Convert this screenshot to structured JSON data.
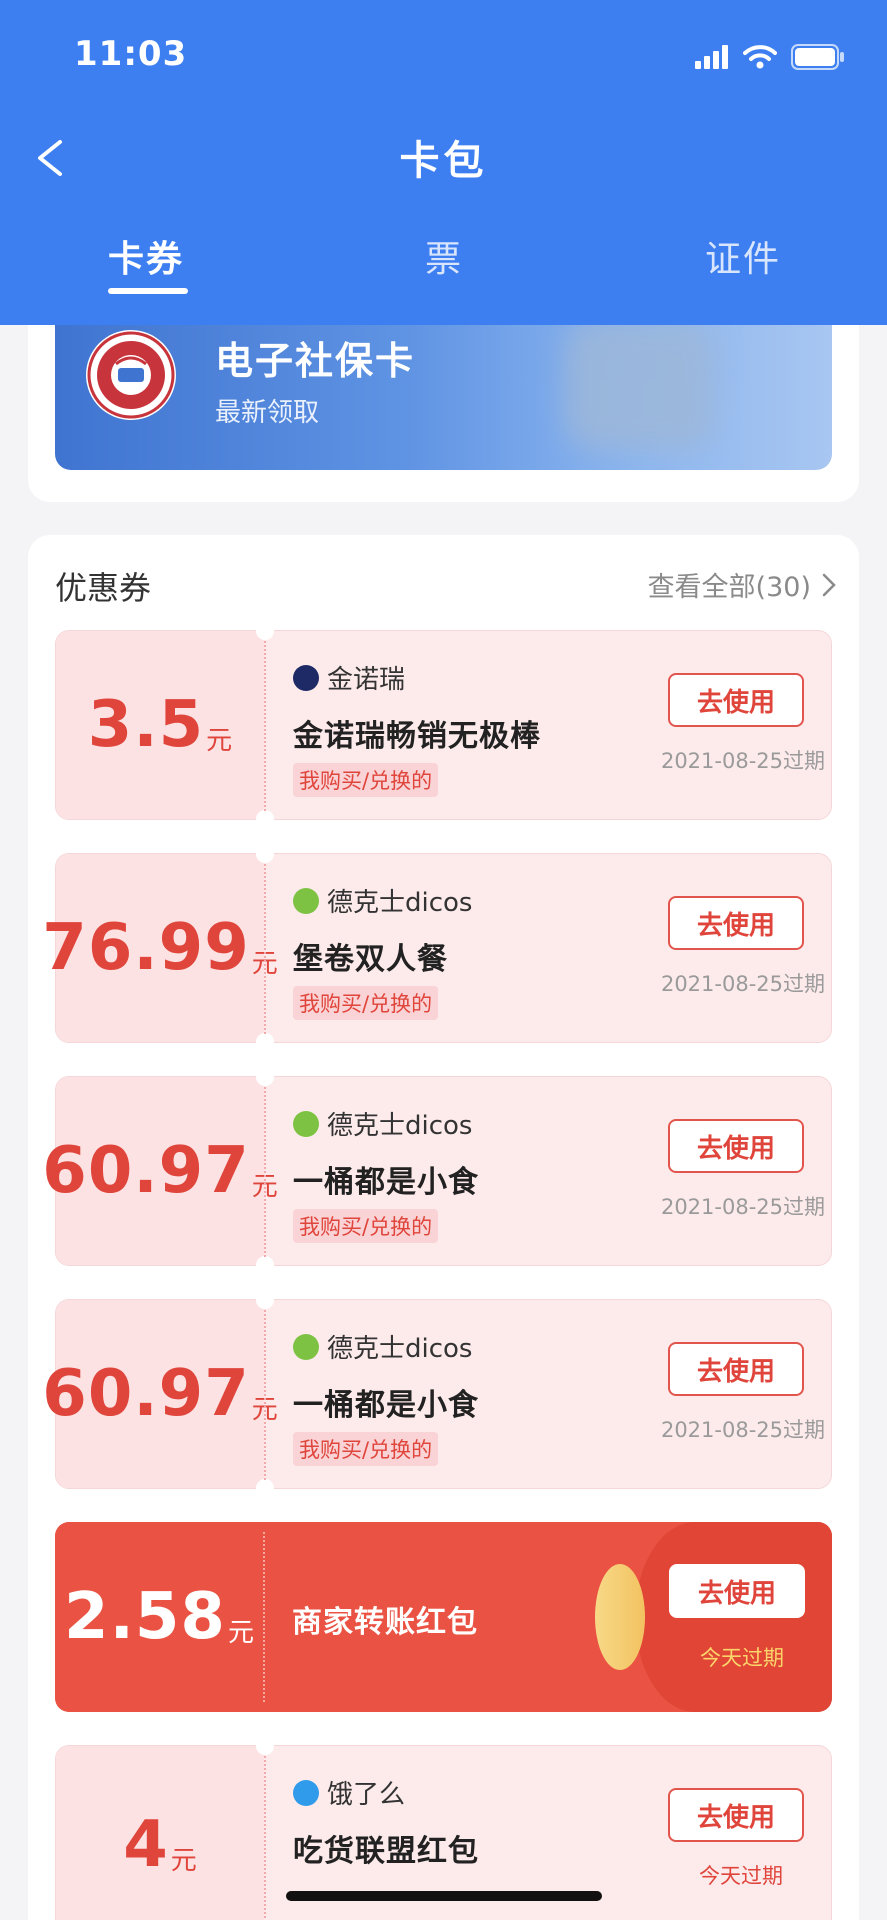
{
  "status_bar": {
    "time": "11:03"
  },
  "header": {
    "title": "卡包",
    "tabs": [
      {
        "label": "卡券"
      },
      {
        "label": "票"
      },
      {
        "label": "证件"
      }
    ]
  },
  "social_security_card": {
    "name": "电子社保卡",
    "subtitle": "最新领取",
    "logo_text": "SOCIAL SECURITY CARD 社会保障卡"
  },
  "coupons_section": {
    "title": "优惠券",
    "view_all": "查看全部(30)"
  },
  "coupons": [
    {
      "amount": "3.5",
      "unit": "元",
      "merchant": "金诺瑞",
      "name": "金诺瑞畅销无极棒",
      "tag": "我购买/兑换的",
      "button": "去使用",
      "expire": "2021-08-25过期",
      "icon_color": "#1e2a66"
    },
    {
      "amount": "76.99",
      "unit": "元",
      "merchant": "德克士dicos",
      "name": "堡卷双人餐",
      "tag": "我购买/兑换的",
      "button": "去使用",
      "expire": "2021-08-25过期",
      "icon_color": "#7dc242"
    },
    {
      "amount": "60.97",
      "unit": "元",
      "merchant": "德克士dicos",
      "name": "一桶都是小食",
      "tag": "我购买/兑换的",
      "button": "去使用",
      "expire": "2021-08-25过期",
      "icon_color": "#7dc242"
    },
    {
      "amount": "60.97",
      "unit": "元",
      "merchant": "德克士dicos",
      "name": "一桶都是小食",
      "tag": "我购买/兑换的",
      "button": "去使用",
      "expire": "2021-08-25过期",
      "icon_color": "#7dc242"
    }
  ],
  "red_packet": {
    "amount": "2.58",
    "unit": "元",
    "name": "商家转账红包",
    "button": "去使用",
    "expire": "今天过期"
  },
  "last_coupon": {
    "amount": "4",
    "unit": "元",
    "merchant": "饿了么",
    "name": "吃货联盟红包",
    "button": "去使用",
    "expire": "今天过期",
    "icon_color": "#2f9bea"
  }
}
